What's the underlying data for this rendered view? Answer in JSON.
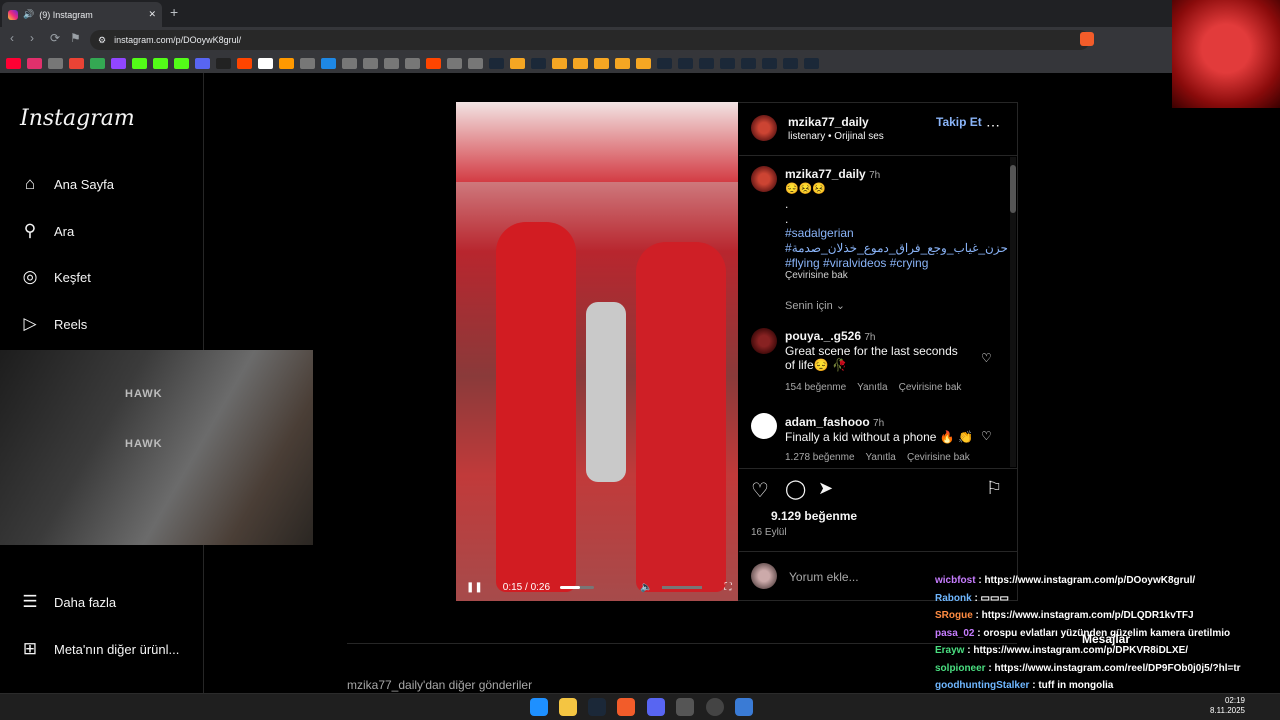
{
  "browser": {
    "tab_title": "(9) Instagram",
    "url": "instagram.com/p/DOoywK8grul/",
    "new_tab": "+"
  },
  "sidebar": {
    "logo": "Instagram",
    "items": [
      {
        "label": "Ana Sayfa",
        "icon": "home-icon"
      },
      {
        "label": "Ara",
        "icon": "search-icon"
      },
      {
        "label": "Keşfet",
        "icon": "compass-icon"
      },
      {
        "label": "Reels",
        "icon": "reels-icon"
      }
    ],
    "more": "Daha fazla",
    "meta": "Meta'nın diğer ürünl..."
  },
  "webcam": {
    "brand1": "HAWK",
    "brand2": "HAWK"
  },
  "post": {
    "username": "mzika77_daily",
    "follow": "Takip Et",
    "audio": "listenary • Orijinal ses",
    "caption_user": "mzika77_daily",
    "caption_time": "7h",
    "caption_emojis": "😔😣😣",
    "caption_dots1": ".",
    "caption_dots2": ".",
    "hashtag1": "#sadalgerian",
    "hashtag2": "#حزن_غياب_وجع_فراق_دموع_خذلان_صدمة",
    "hashtag3": "#flying #viralvideos #crying",
    "see_translation": "Çevirisine bak",
    "for_you": "Senin için",
    "comments": [
      {
        "user": "pouya._.g526",
        "time": "7h",
        "text": "Great scene for the last seconds of life😔 🥀",
        "likes": "154 beğenme",
        "reply": "Yanıtla",
        "translate": "Çevirisine bak"
      },
      {
        "user": "adam_fashooo",
        "time": "7h",
        "text": "Finally a kid without a phone 🔥 👏",
        "likes": "1.278 beğenme",
        "reply": "Yanıtla",
        "translate": "Çevirisine bak"
      }
    ],
    "likes": "9.129 beğenme",
    "date": "16 Eylül",
    "comment_placeholder": "Yorum ekle...",
    "video_time": "0:15 / 0:26",
    "video_progress": 0.58,
    "more_from": "mzika77_daily'dan diğer gönderiler"
  },
  "chat": [
    {
      "user": "wicbfost",
      "text": ": https://www.instagram.com/p/DOoywK8grul/",
      "color": "#c77dff"
    },
    {
      "user": "Rabonk",
      "text": ": ▭▭▭",
      "color": "#6fb7ff"
    },
    {
      "user": "SRogue",
      "text": ": https://www.instagram.com/p/DLQDR1kvTFJ",
      "color": "#ff8c42"
    },
    {
      "user": "pasa_02",
      "text": ": orospu evlatları yüzünden güzelim kamera üretilmio",
      "color": "#c77dff"
    },
    {
      "user": "Erayw",
      "text": ": https://www.instagram.com/p/DPKVR8iDLXE/",
      "color": "#4ade80"
    },
    {
      "user": "solpioneer",
      "text": ": https://www.instagram.com/reel/DP9FOb0j0j5/?hl=tr",
      "color": "#4ade80"
    },
    {
      "user": "goodhuntingStalker",
      "text": ": tuff in mongolia",
      "color": "#6fb7ff"
    }
  ],
  "messages_label": "Mesajlar",
  "clock": {
    "time": "02:19",
    "date": "8.11.2025"
  }
}
